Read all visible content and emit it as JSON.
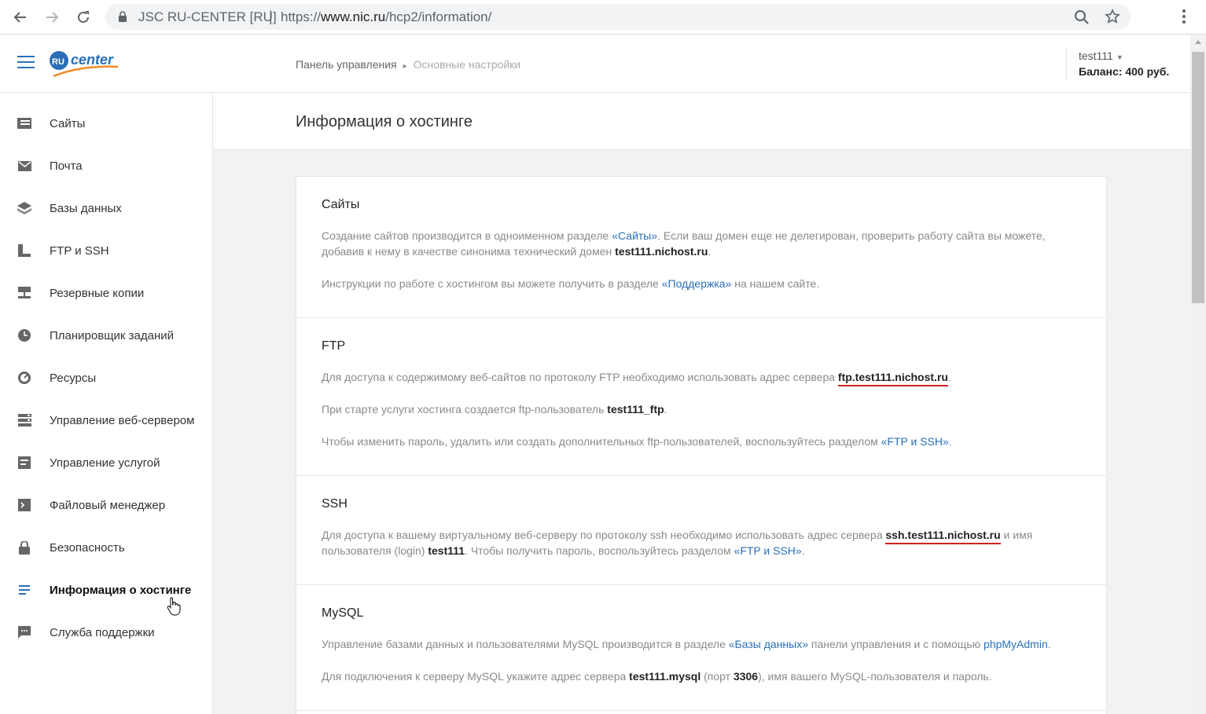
{
  "browser": {
    "site_identity": "JSC RU-CENTER [RU]",
    "url_scheme": "https://",
    "url_host": "www.nic.ru",
    "url_path": "/hcp2/information/"
  },
  "header": {
    "logo_text": "center",
    "logo_badge": "RU",
    "breadcrumb": [
      "Панель управления",
      "Основные настройки"
    ],
    "account": {
      "username": "test111",
      "balance": "Баланс: 400 руб."
    }
  },
  "sidebar": {
    "items": [
      {
        "label": "Сайты",
        "icon": "sites-icon"
      },
      {
        "label": "Почта",
        "icon": "mail-icon"
      },
      {
        "label": "Базы данных",
        "icon": "database-icon"
      },
      {
        "label": "FTP и SSH",
        "icon": "ftp-icon"
      },
      {
        "label": "Резервные копии",
        "icon": "backup-icon"
      },
      {
        "label": "Планировщик заданий",
        "icon": "clock-icon"
      },
      {
        "label": "Ресурсы",
        "icon": "gauge-icon"
      },
      {
        "label": "Управление веб-сервером",
        "icon": "server-icon"
      },
      {
        "label": "Управление услугой",
        "icon": "service-icon"
      },
      {
        "label": "Файловый менеджер",
        "icon": "terminal-icon"
      },
      {
        "label": "Безопасность",
        "icon": "lock-icon"
      },
      {
        "label": "Информация о хостинге",
        "icon": "info-lines-icon"
      },
      {
        "label": "Служба поддержки",
        "icon": "chat-icon"
      }
    ],
    "active_index": 11
  },
  "main": {
    "title": "Информация о хостинге",
    "sections": {
      "sites": {
        "title": "Сайты",
        "p1_a": "Создание сайтов производится в одноименном разделе ",
        "p1_link": "«Сайты»",
        "p1_b": ". Если ваш домен еще не делегирован, проверить работу сайта вы можете, добавив к нему в качестве синонима технический домен ",
        "p1_domain": "test111.nichost.ru",
        "p1_end": ".",
        "p2_a": "Инструкции по работе с хостингом вы можете получить в разделе ",
        "p2_link": "«Поддержка»",
        "p2_b": " на нашем сайте."
      },
      "ftp": {
        "title": "FTP",
        "p1_a": "Для доступа к содержимому веб-сайтов по протоколу FTP необходимо использовать адрес сервера ",
        "p1_server": "ftp.test111.nichost.ru",
        "p1_end": ".",
        "p2_a": "При старте услуги хостинга создается ftp-пользователь ",
        "p2_user": "test111_ftp",
        "p2_end": ".",
        "p3_a": "Чтобы изменить пароль, удалить или создать дополнительных ftp-пользователей, воспользуйтесь разделом ",
        "p3_link": "«FTP и SSH»",
        "p3_end": "."
      },
      "ssh": {
        "title": "SSH",
        "p1_a": "Для доступа к вашему виртуальному веб-серверу по протоколу ssh необходимо использовать адрес сервера ",
        "p1_server": "ssh.test111.nichost.ru",
        "p1_b": " и имя пользователя (login) ",
        "p1_login": "test111",
        "p1_c": ". Чтобы получить пароль, воспользуйтесь разделом ",
        "p1_link": "«FTP и SSH»",
        "p1_end": "."
      },
      "mysql": {
        "title": "MySQL",
        "p1_a": "Управление базами данных и пользователями MySQL производится в разделе ",
        "p1_link": "«Базы данных»",
        "p1_b": " панели управления и с помощью ",
        "p1_link2": "phpMyAdmin",
        "p1_end": ".",
        "p2_a": "Для подключения к серверу MySQL укажите адрес сервера ",
        "p2_server": "test111.mysql",
        "p2_b": " (порт ",
        "p2_port": "3306",
        "p2_c": "), имя вашего MySQL-пользователя и пароль."
      }
    }
  },
  "colors": {
    "accent_blue": "#2a6fb8",
    "logo_orange": "#f08a24",
    "underline_red": "#d42020"
  }
}
